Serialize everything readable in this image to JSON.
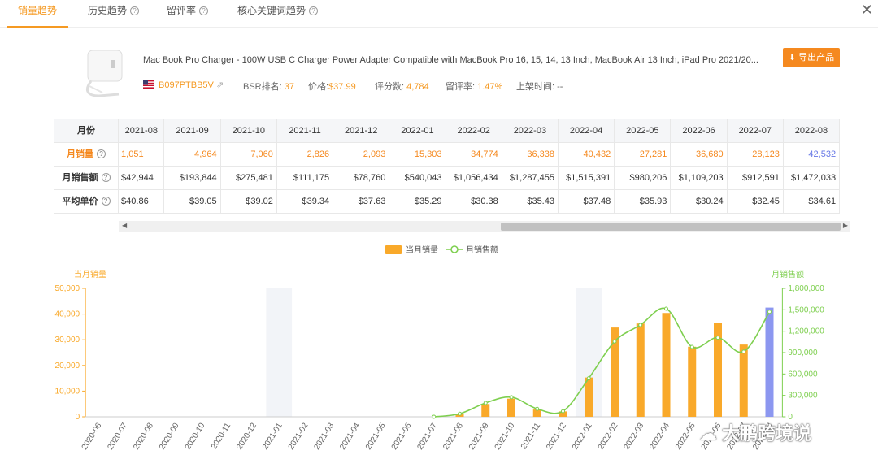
{
  "tabs": [
    {
      "label": "销量趋势"
    },
    {
      "label": "历史趋势"
    },
    {
      "label": "留评率"
    },
    {
      "label": "核心关键词趋势"
    }
  ],
  "product": {
    "title": "Mac Book Pro Charger - 100W USB C Charger Power Adapter Compatible with MacBook Pro 16, 15, 14, 13 Inch, MacBook Air 13 Inch, iPad Pro 2021/20...",
    "asin": "B097PTBB5V",
    "bsr_label": "BSR排名:",
    "bsr_value": "37",
    "price_label": "价格:",
    "price_value": "$37.99",
    "reviews_label": "评分数:",
    "reviews_value": "4,784",
    "review_rate_label": "留评率:",
    "review_rate_value": "1.47%",
    "listed_label": "上架时间:",
    "listed_value": "--",
    "export_label": "导出产品"
  },
  "table": {
    "row_headers": {
      "month": "月份",
      "sales": "月销量",
      "revenue": "月销售额",
      "avg_price": "平均单价"
    },
    "months": [
      "2021-08",
      "2021-09",
      "2021-10",
      "2021-11",
      "2021-12",
      "2022-01",
      "2022-02",
      "2022-03",
      "2022-04",
      "2022-05",
      "2022-06",
      "2022-07",
      "2022-08"
    ],
    "sales": [
      "1,051",
      "4,964",
      "7,060",
      "2,826",
      "2,093",
      "15,303",
      "34,774",
      "36,338",
      "40,432",
      "27,281",
      "36,680",
      "28,123",
      "42,532"
    ],
    "revenue": [
      "$42,944",
      "$193,844",
      "$275,481",
      "$111,175",
      "$78,760",
      "$540,043",
      "$1,056,434",
      "$1,287,455",
      "$1,515,391",
      "$980,206",
      "$1,109,203",
      "$912,591",
      "$1,472,033"
    ],
    "avg_price": [
      "$40.86",
      "$39.05",
      "$39.02",
      "$39.34",
      "$37.63",
      "$35.29",
      "$30.38",
      "$35.43",
      "$37.48",
      "$35.93",
      "$30.24",
      "$32.45",
      "$34.61"
    ]
  },
  "chart_data": {
    "type": "bar",
    "legend": [
      "当月销量",
      "月销售额"
    ],
    "left_axis_title": "当月销量",
    "right_axis_title": "月销售额",
    "left_ylim": [
      0,
      50000
    ],
    "right_ylim": [
      0,
      1800000
    ],
    "left_ticks": [
      "0",
      "10,000",
      "20,000",
      "30,000",
      "40,000",
      "50,000"
    ],
    "right_ticks": [
      "0",
      "300,000",
      "600,000",
      "900,000",
      "1,200,000",
      "1,500,000",
      "1,800,000"
    ],
    "categories": [
      "2020-06",
      "2020-07",
      "2020-08",
      "2020-09",
      "2020-10",
      "2020-11",
      "2020-12",
      "2021-01",
      "2021-02",
      "2021-03",
      "2021-04",
      "2021-05",
      "2021-06",
      "2021-07",
      "2021-08",
      "2021-09",
      "2021-10",
      "2021-11",
      "2021-12",
      "2022-01",
      "2022-02",
      "2022-03",
      "2022-04",
      "2022-05",
      "2022-06",
      "2022-07",
      "2022-08"
    ],
    "series": [
      {
        "name": "当月销量",
        "type": "bar",
        "values": [
          0,
          0,
          0,
          0,
          0,
          0,
          0,
          0,
          0,
          0,
          0,
          0,
          0,
          0,
          1051,
          4964,
          7060,
          2826,
          2093,
          15303,
          34774,
          36338,
          40432,
          27281,
          36680,
          28123,
          42532
        ]
      },
      {
        "name": "月销售额",
        "type": "line",
        "values": [
          null,
          null,
          null,
          null,
          null,
          null,
          null,
          null,
          null,
          null,
          null,
          null,
          null,
          0,
          42944,
          193844,
          275481,
          111175,
          78760,
          540043,
          1056434,
          1287455,
          1515391,
          980206,
          1109203,
          912591,
          1472033
        ]
      }
    ],
    "highlight_last_bar": true,
    "bar_color": "#f9a92a",
    "highlight_color": "#8c97f0",
    "line_color": "#7ecf4f",
    "shaded_categories": [
      "2021-01",
      "2022-01"
    ]
  },
  "watermark": "大鹏跨境说"
}
